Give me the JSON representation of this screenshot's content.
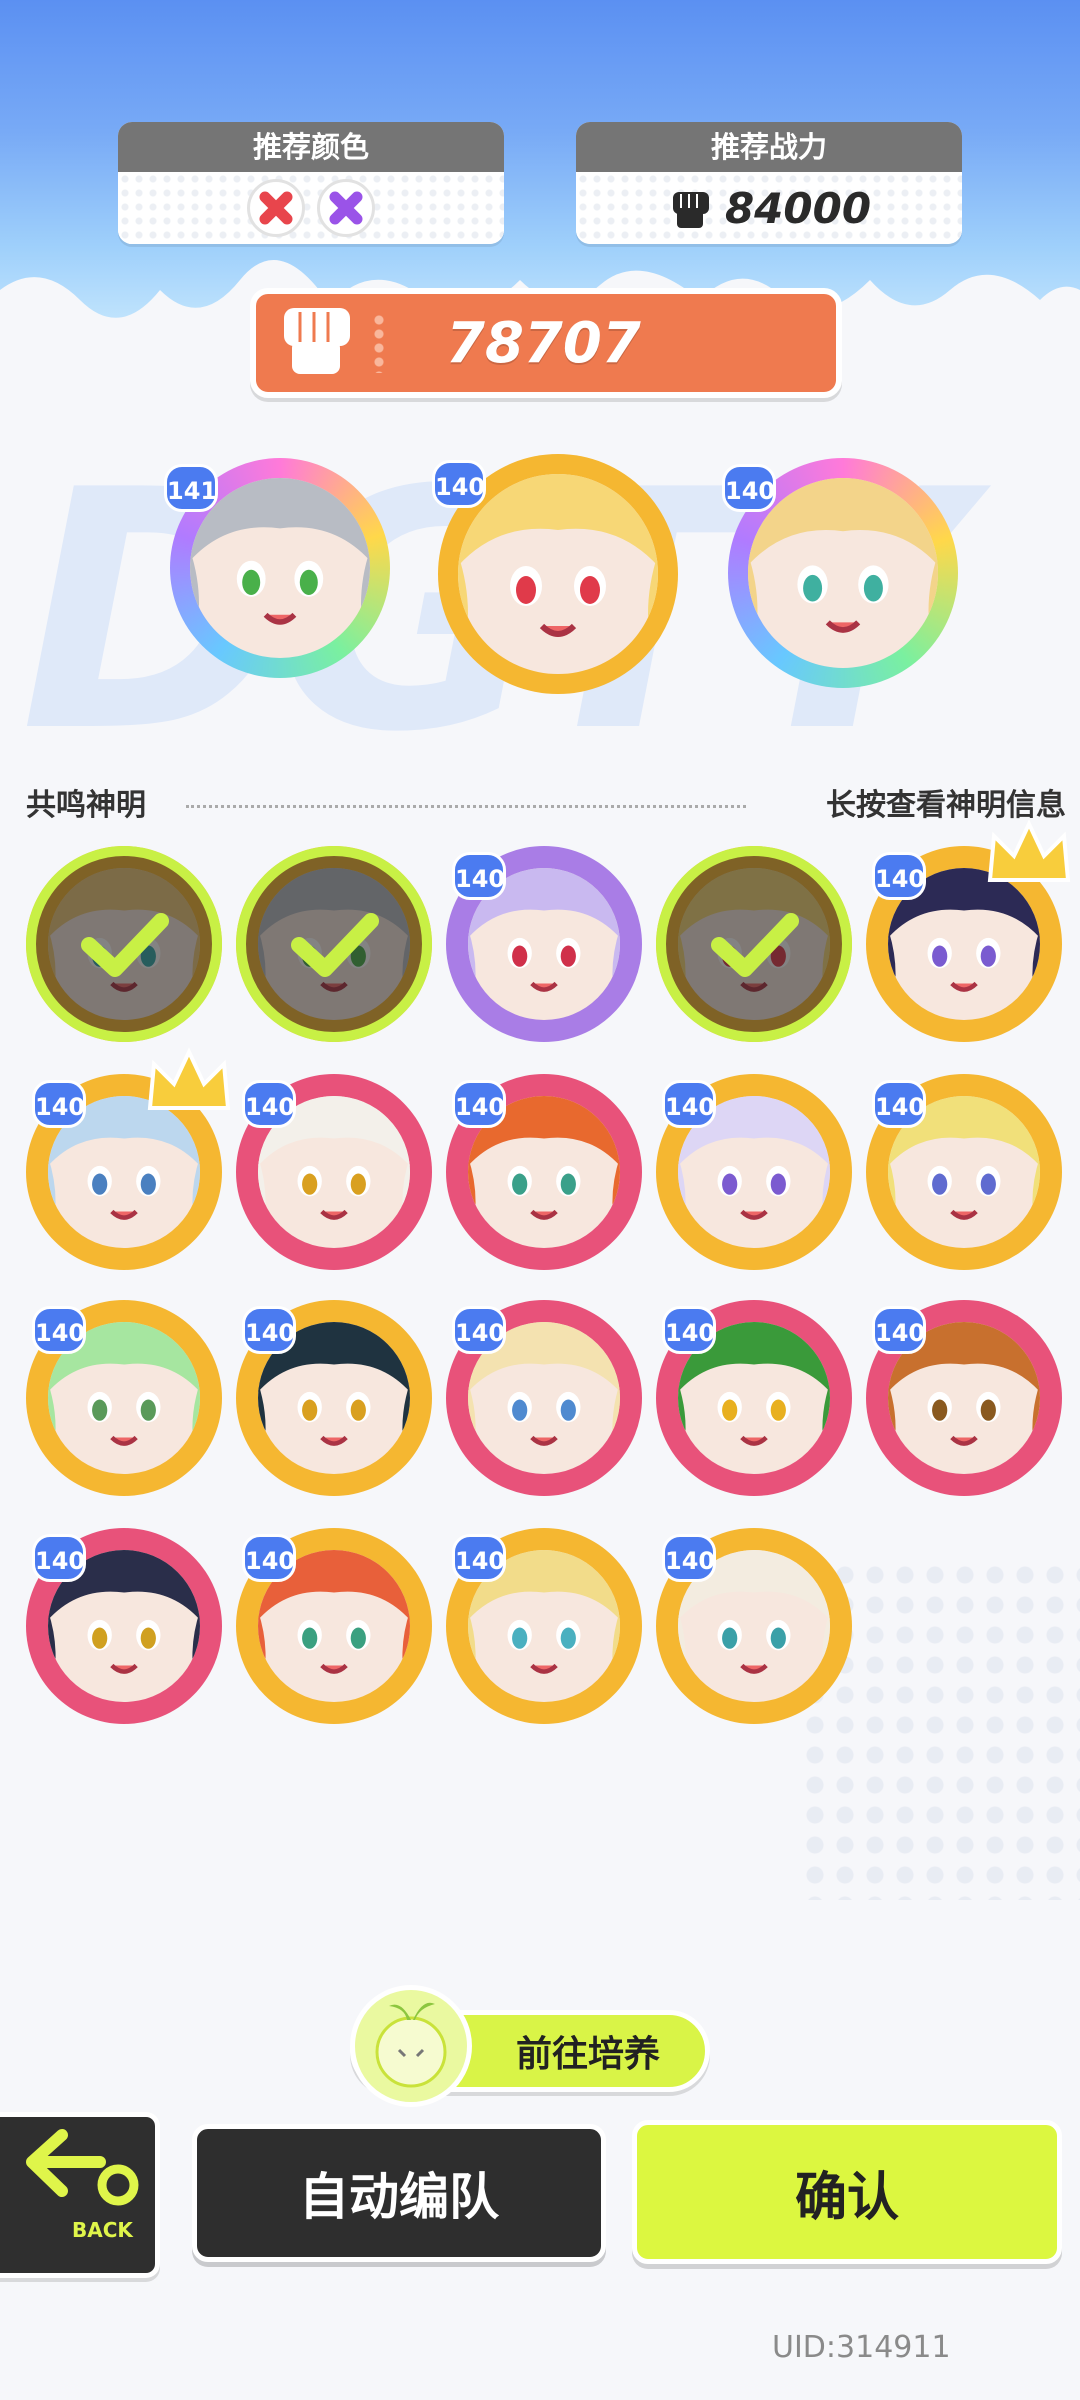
{
  "recommend_color": {
    "title": "推荐颜色",
    "colors": [
      "#e8454c",
      "#9a53e8"
    ]
  },
  "recommend_power": {
    "title": "推荐战力",
    "value": "84000"
  },
  "team_power": "78707",
  "section": {
    "left_label": "共鸣神明",
    "right_label": "长按查看神明信息"
  },
  "team_slots": [
    {
      "level": "141",
      "ring": "rainbow",
      "hair": "#b8bcc4",
      "eye": "#49b04a"
    },
    {
      "level": "140",
      "ring": "#f5b731",
      "hair": "#f7d776",
      "eye": "#e03a4a"
    },
    {
      "level": "140",
      "ring": "rainbow",
      "hair": "#f3d48a",
      "eye": "#3fb0a0"
    }
  ],
  "roster": [
    {
      "level": "",
      "ring": "#f5b731",
      "hair": "#f0c97a",
      "eye": "#3aa",
      "selected": true,
      "crown": false
    },
    {
      "level": "",
      "ring": "#f5b731",
      "hair": "#b8bcc4",
      "eye": "#49b04a",
      "selected": true,
      "crown": false
    },
    {
      "level": "140",
      "ring": "#a97de6",
      "hair": "#c9b9f0",
      "eye": "#d0304a",
      "selected": false,
      "crown": false
    },
    {
      "level": "",
      "ring": "#f5b731",
      "hair": "#f7d776",
      "eye": "#e03a4a",
      "selected": true,
      "crown": false
    },
    {
      "level": "140",
      "ring": "#f5b731",
      "hair": "#2c2a55",
      "eye": "#7a5bd0",
      "selected": false,
      "crown": true
    },
    {
      "level": "140",
      "ring": "#f5b731",
      "hair": "#bcd7ee",
      "eye": "#4a80c0",
      "selected": false,
      "crown": true
    },
    {
      "level": "140",
      "ring": "#e8527a",
      "hair": "#f3f0ea",
      "eye": "#d9a020",
      "selected": false,
      "crown": false
    },
    {
      "level": "140",
      "ring": "#e8527a",
      "hair": "#e8692e",
      "eye": "#3aa08a",
      "selected": false,
      "crown": false
    },
    {
      "level": "140",
      "ring": "#f5b731",
      "hair": "#ddd6f5",
      "eye": "#7b5bd0",
      "selected": false,
      "crown": false
    },
    {
      "level": "140",
      "ring": "#f5b731",
      "hair": "#f1e07a",
      "eye": "#5f6bd0",
      "selected": false,
      "crown": false
    },
    {
      "level": "140",
      "ring": "#f5b731",
      "hair": "#a6e6a0",
      "eye": "#5a9a5a",
      "selected": false,
      "crown": false
    },
    {
      "level": "140",
      "ring": "#f5b731",
      "hair": "#1f3340",
      "eye": "#d9a020",
      "selected": false,
      "crown": false
    },
    {
      "level": "140",
      "ring": "#e8527a",
      "hair": "#f4e2b0",
      "eye": "#4f8ad0",
      "selected": false,
      "crown": false
    },
    {
      "level": "140",
      "ring": "#e8527a",
      "hair": "#3a9a3a",
      "eye": "#e8b020",
      "selected": false,
      "crown": false
    },
    {
      "level": "140",
      "ring": "#e8527a",
      "hair": "#c8702e",
      "eye": "#8a5a20",
      "selected": false,
      "crown": false
    },
    {
      "level": "140",
      "ring": "#e8527a",
      "hair": "#2a2e4a",
      "eye": "#d0a020",
      "selected": false,
      "crown": false
    },
    {
      "level": "140",
      "ring": "#f5b731",
      "hair": "#e8603a",
      "eye": "#3aa080",
      "selected": false,
      "crown": false
    },
    {
      "level": "140",
      "ring": "#f5b731",
      "hair": "#f2dc8a",
      "eye": "#4ab0c0",
      "selected": false,
      "crown": false
    },
    {
      "level": "140",
      "ring": "#f5b731",
      "hair": "#f3ece0",
      "eye": "#3aa0a8",
      "selected": false,
      "crown": false
    }
  ],
  "buttons": {
    "grow": "前往培养",
    "back": "BACK",
    "auto": "自动编队",
    "confirm": "确认"
  },
  "uid": "UID:314911"
}
